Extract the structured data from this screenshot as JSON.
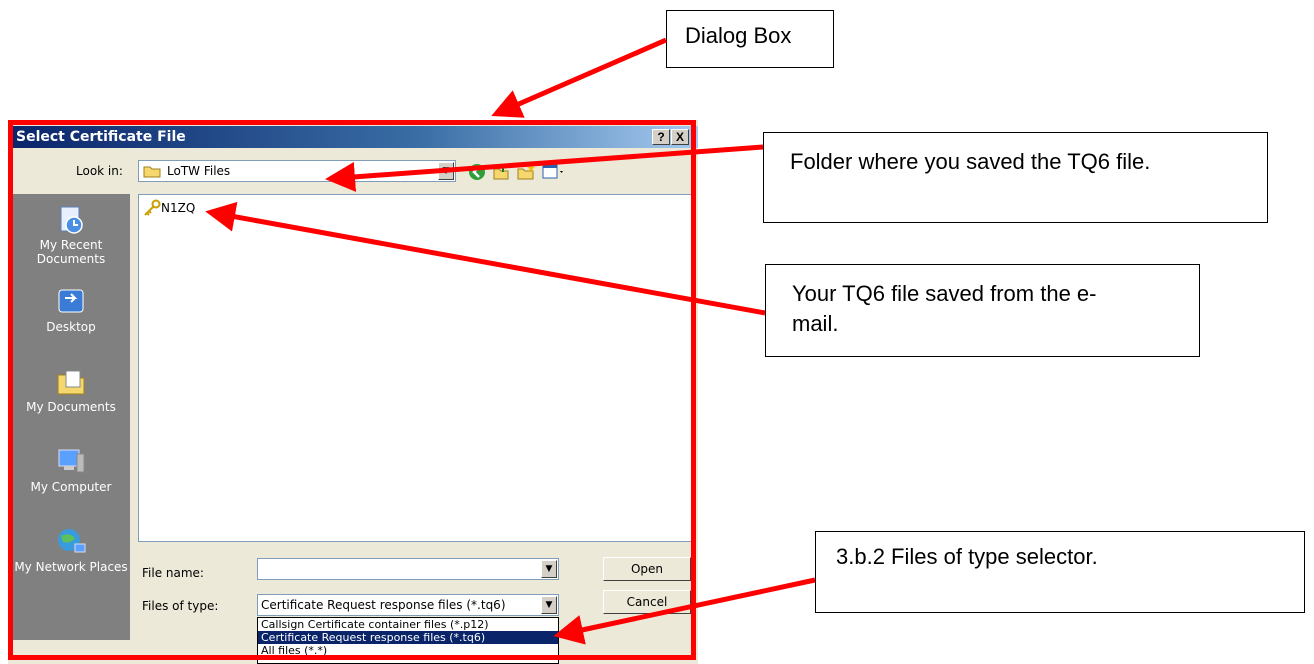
{
  "callouts": {
    "dialog_box": "Dialog Box",
    "folder": "Folder where you saved the TQ6 file.",
    "tq6_file": "Your TQ6 file saved from the e-mail.",
    "files_of_type": "3.b.2 Files of type selector."
  },
  "dialog": {
    "title": "Select Certificate File",
    "help_button": "?",
    "close_button": "X",
    "look_in_label": "Look in:",
    "look_in_value": "LoTW Files",
    "places": [
      {
        "label": "My Recent Documents",
        "icon": "recent-documents-icon"
      },
      {
        "label": "Desktop",
        "icon": "desktop-icon"
      },
      {
        "label": "My Documents",
        "icon": "my-documents-icon"
      },
      {
        "label": "My Computer",
        "icon": "my-computer-icon"
      },
      {
        "label": "My Network Places",
        "icon": "network-places-icon"
      }
    ],
    "files": [
      {
        "name": "N1ZQ",
        "icon": "certificate-key-icon"
      }
    ],
    "file_name_label": "File name:",
    "file_name_value": "",
    "files_of_type_label": "Files of type:",
    "files_of_type_value": "Certificate Request response files (*.tq6)",
    "open_button": "Open",
    "cancel_button": "Cancel",
    "type_options": [
      "Callsign Certificate container files (*.p12)",
      "Certificate Request response files (*.tq6)",
      "All files (*.*)"
    ],
    "selected_type_index": 1
  },
  "colors": {
    "annotation_red": "#ff0000",
    "titlebar_start": "#0a246a",
    "selection": "#0a246a"
  }
}
